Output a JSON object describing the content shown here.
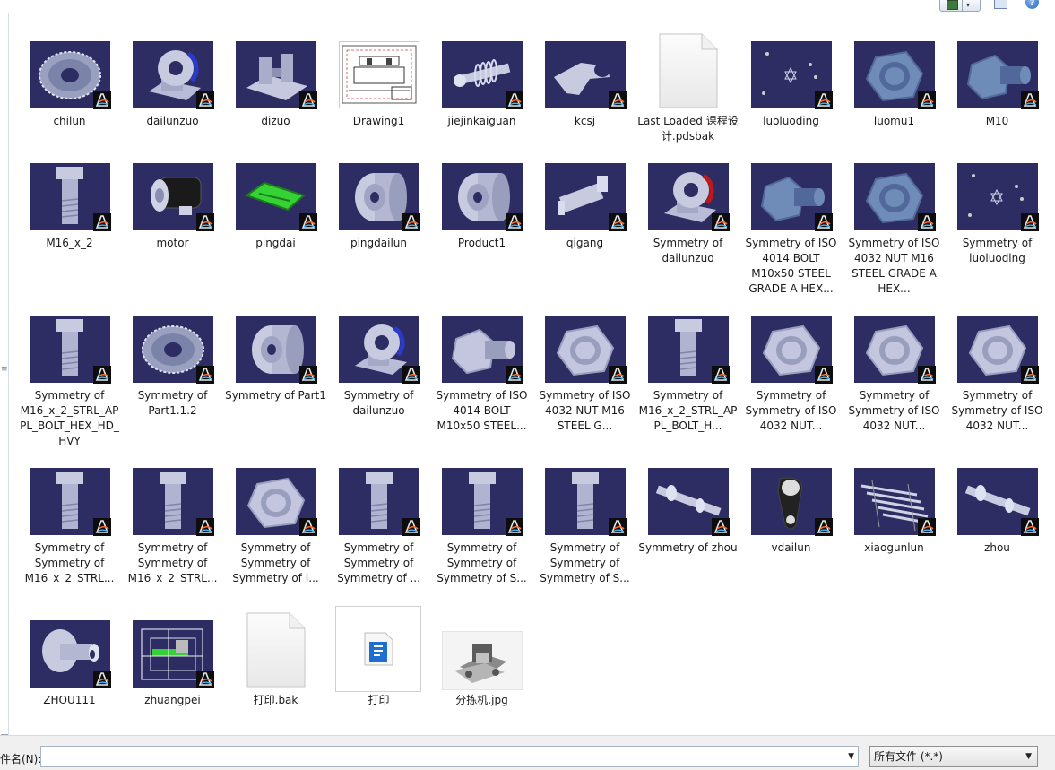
{
  "files": [
    {
      "label": "chilun",
      "kind": "gear"
    },
    {
      "label": "dailunzuo",
      "kind": "bearing"
    },
    {
      "label": "dizuo",
      "kind": "base"
    },
    {
      "label": "Drawing1",
      "kind": "drawing"
    },
    {
      "label": "jiejinkaiguan",
      "kind": "shaft-spring"
    },
    {
      "label": "kcsj",
      "kind": "bracket"
    },
    {
      "label": "Last Loaded 课程设计.pdsbak",
      "kind": "blank-doc"
    },
    {
      "label": "luoluoding",
      "kind": "points"
    },
    {
      "label": "luomu1",
      "kind": "nut"
    },
    {
      "label": "M10",
      "kind": "bolt-head"
    },
    {
      "label": "M16_x_2",
      "kind": "bolt"
    },
    {
      "label": "motor",
      "kind": "motor"
    },
    {
      "label": "pingdai",
      "kind": "belt"
    },
    {
      "label": "pingdailun",
      "kind": "pulley"
    },
    {
      "label": "Product1",
      "kind": "pulley"
    },
    {
      "label": "qigang",
      "kind": "cylinder"
    },
    {
      "label": "Symmetry of dailunzuo",
      "kind": "bearing-red"
    },
    {
      "label": "Symmetry of ISO 4014 BOLT M10x50 STEEL GRADE A HEX...",
      "kind": "bolt-head"
    },
    {
      "label": "Symmetry of ISO 4032 NUT M16 STEEL GRADE A HEX...",
      "kind": "nut"
    },
    {
      "label": "Symmetry of luoluoding",
      "kind": "points"
    },
    {
      "label": "Symmetry of M16_x_2_STRL_APPL_BOLT_HEX_HD_HVY",
      "kind": "bolt"
    },
    {
      "label": "Symmetry of Part1.1.2",
      "kind": "gear"
    },
    {
      "label": "Symmetry of Part1",
      "kind": "pulley"
    },
    {
      "label": "Symmetry of dailunzuo",
      "kind": "bearing"
    },
    {
      "label": "Symmetry of ISO 4014 BOLT M10x50 STEEL...",
      "kind": "bolt-head-light"
    },
    {
      "label": "Symmetry of ISO 4032 NUT M16 STEEL G...",
      "kind": "nut-light"
    },
    {
      "label": "Symmetry of M16_x_2_STRL_APPL_BOLT_H...",
      "kind": "bolt"
    },
    {
      "label": "Symmetry of Symmetry of ISO 4032 NUT...",
      "kind": "nut-light"
    },
    {
      "label": "Symmetry of Symmetry of ISO 4032 NUT...",
      "kind": "nut-light"
    },
    {
      "label": "Symmetry of Symmetry of ISO 4032 NUT...",
      "kind": "nut-light"
    },
    {
      "label": "Symmetry of Symmetry of M16_x_2_STRL...",
      "kind": "bolt"
    },
    {
      "label": "Symmetry of Symmetry of M16_x_2_STRL...",
      "kind": "bolt"
    },
    {
      "label": "Symmetry of Symmetry of Symmetry of I...",
      "kind": "nut-light"
    },
    {
      "label": "Symmetry of Symmetry of Symmetry of ...",
      "kind": "bolt"
    },
    {
      "label": "Symmetry of Symmetry of Symmetry of S...",
      "kind": "bolt"
    },
    {
      "label": "Symmetry of Symmetry of Symmetry of S...",
      "kind": "bolt"
    },
    {
      "label": "Symmetry of zhou",
      "kind": "shaft"
    },
    {
      "label": "vdailun",
      "kind": "vbelt"
    },
    {
      "label": "xiaogunlun",
      "kind": "rollers"
    },
    {
      "label": "zhou",
      "kind": "shaft"
    },
    {
      "label": "ZHOU111",
      "kind": "zhou111"
    },
    {
      "label": "zhuangpei",
      "kind": "assembly"
    },
    {
      "label": "打印.bak",
      "kind": "blank-doc"
    },
    {
      "label": "打印",
      "kind": "print-doc"
    },
    {
      "label": "分拣机.jpg",
      "kind": "photo"
    }
  ],
  "bottom": {
    "filename_label": "件名(N):",
    "filename_value": "",
    "filetype_value": "所有文件 (*.*)"
  },
  "icons": {
    "view": "view-menu-icon",
    "preview_pane": "preview-pane-icon",
    "help": "help-icon",
    "badge": "catia-3ds-logo-icon"
  },
  "colors": {
    "thumb_bg": "#2d2d63",
    "part_metal": "#c8cbe0",
    "belt_green": "#35d235",
    "accent_blue": "#2a66b8"
  }
}
